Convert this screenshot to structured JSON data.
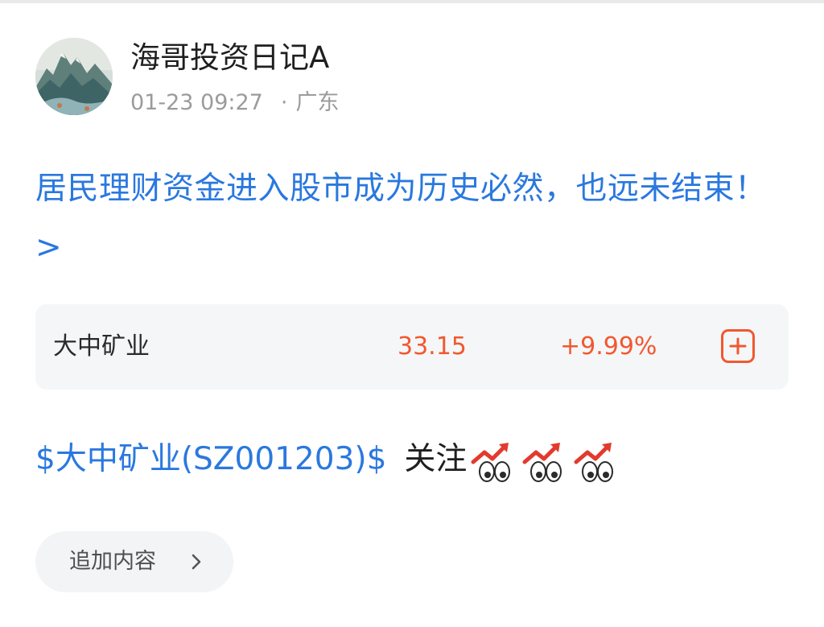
{
  "post": {
    "author": "海哥投资日记A",
    "time": "01-23 09:27",
    "separator": "·",
    "location": "广东",
    "headline": "居民理财资金进入股市成为历史必然，也远未结束！ >"
  },
  "stock_card": {
    "name": "大中矿业",
    "price": "33.15",
    "change": "+9.99%",
    "add_icon": "plus-square-icon",
    "accent_color": "#f1582f"
  },
  "body": {
    "stock_tag": "$大中矿业(SZ001203)$",
    "text": "关注",
    "emoji": "chart-up-eyes-emoji",
    "emoji_count": 3,
    "link_color": "#2a78df"
  },
  "actions": {
    "append_label": "追加内容",
    "append_icon": "chevron-right-icon"
  }
}
